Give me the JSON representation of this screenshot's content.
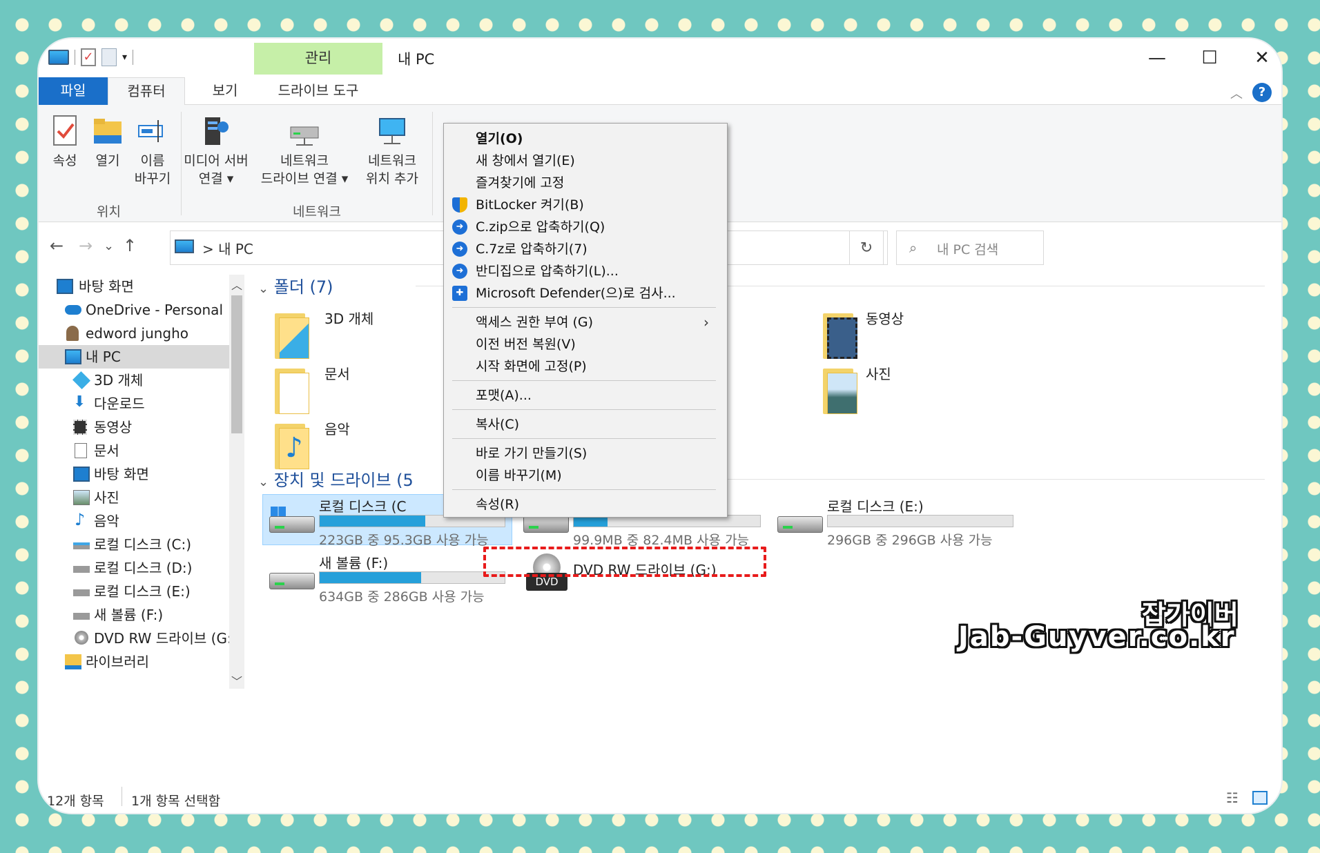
{
  "window": {
    "title": "내 PC",
    "contextual_tab": "관리",
    "controls": {
      "minimize": "—",
      "maximize": "☐",
      "close": "✕"
    },
    "help": "?"
  },
  "ribbon_tabs": [
    {
      "label": "파일"
    },
    {
      "label": "컴퓨터"
    },
    {
      "label": "보기"
    },
    {
      "label": "드라이브 도구"
    }
  ],
  "ribbon": {
    "location_group": {
      "label": "위치",
      "buttons": [
        {
          "label": "속성",
          "icon": "properties-icon"
        },
        {
          "label": "열기",
          "icon": "open-folder-icon"
        },
        {
          "label": "이름\n바꾸기",
          "line1": "이름",
          "line2": "바꾸기",
          "icon": "rename-icon"
        }
      ]
    },
    "network_group": {
      "label": "네트워크",
      "buttons": [
        {
          "line1": "미디어 서버",
          "line2": "연결 ▾",
          "icon": "media-server-icon"
        },
        {
          "line1": "네트워크",
          "line2": "드라이브 연결 ▾",
          "icon": "network-drive-icon"
        },
        {
          "line1": "네트워크",
          "line2": "위치 추가",
          "icon": "network-location-icon"
        }
      ]
    }
  },
  "address": {
    "back": "←",
    "forward": "→",
    "recent": "⌄",
    "up": "↑",
    "crumb": "> 내 PC",
    "dropdown": "⌄",
    "refresh": "↻",
    "search_placeholder": "내 PC 검색"
  },
  "nav_pane": [
    {
      "label": "바탕 화면",
      "icon": "desktop-icon",
      "indent": 0
    },
    {
      "label": "OneDrive - Personal",
      "icon": "onedrive-icon",
      "indent": 1
    },
    {
      "label": "edword jungho",
      "icon": "user-icon",
      "indent": 1
    },
    {
      "label": "내 PC",
      "icon": "pc-icon",
      "indent": 1,
      "selected": true
    },
    {
      "label": "3D 개체",
      "icon": "3d-objects-icon",
      "indent": 2
    },
    {
      "label": "다운로드",
      "icon": "download-icon",
      "indent": 2
    },
    {
      "label": "동영상",
      "icon": "video-icon",
      "indent": 2
    },
    {
      "label": "문서",
      "icon": "document-icon",
      "indent": 2
    },
    {
      "label": "바탕 화면",
      "icon": "desktop-icon",
      "indent": 2
    },
    {
      "label": "사진",
      "icon": "picture-icon",
      "indent": 2
    },
    {
      "label": "음악",
      "icon": "music-icon",
      "indent": 2
    },
    {
      "label": "로컬 디스크 (C:)",
      "icon": "windows-drive-icon",
      "indent": 2
    },
    {
      "label": "로컬 디스크 (D:)",
      "icon": "drive-icon",
      "indent": 2
    },
    {
      "label": "로컬 디스크 (E:)",
      "icon": "drive-icon",
      "indent": 2
    },
    {
      "label": "새 볼륨 (F:)",
      "icon": "drive-icon",
      "indent": 2
    },
    {
      "label": "DVD RW 드라이브 (G:)",
      "icon": "dvd-icon",
      "indent": 2
    },
    {
      "label": "라이브러리",
      "icon": "library-icon",
      "indent": 1
    }
  ],
  "sections": {
    "folders": "폴더 (7)",
    "devices": "장치 및 드라이브 (5"
  },
  "folders": [
    {
      "name": "3D 개체",
      "icon": "3d-objects-icon"
    },
    {
      "name": "문서",
      "icon": "document-icon"
    },
    {
      "name": "음악",
      "icon": "music-icon"
    },
    {
      "name": "동영상",
      "icon": "video-icon"
    },
    {
      "name": "사진",
      "icon": "picture-icon"
    }
  ],
  "drives": [
    {
      "name": "로컬 디스크 (C",
      "info": "223GB 중 95.3GB 사용 가능",
      "used": 0.57,
      "selected": true,
      "icon": "windows-drive-icon"
    },
    {
      "name": "",
      "info": "99.9MB 중 82.4MB 사용 가능",
      "used": 0.18,
      "icon": "drive-icon"
    },
    {
      "name": "로컬 디스크 (E:)",
      "info": "296GB 중 296GB 사용 가능",
      "used": 0.0,
      "icon": "drive-icon"
    },
    {
      "name": "새 볼륨 (F:)",
      "info": "634GB 중 286GB 사용 가능",
      "used": 0.55,
      "icon": "drive-icon"
    },
    {
      "name": "DVD RW 드라이브 (G:)",
      "icon": "dvd-icon",
      "badge": "DVD"
    }
  ],
  "context_menu": [
    {
      "label": "열기(O)",
      "bold": true
    },
    {
      "label": "새 창에서 열기(E)"
    },
    {
      "label": "즐겨찾기에 고정"
    },
    {
      "label": "BitLocker 켜기(B)",
      "icon": "shield-icon"
    },
    {
      "label": "C.zip으로 압축하기(Q)",
      "icon": "bandizip-icon"
    },
    {
      "label": "C.7z로 압축하기(7)",
      "icon": "bandizip-icon"
    },
    {
      "label": "반디집으로 압축하기(L)...",
      "icon": "bandizip-icon"
    },
    {
      "label": "Microsoft Defender(으)로 검사...",
      "icon": "defender-icon"
    },
    {
      "label": "액세스 권한 부여 (G)",
      "submenu": "›"
    },
    {
      "label": "이전 버전 복원(V)"
    },
    {
      "label": "시작 화면에 고정(P)"
    },
    {
      "label": "포맷(A)..."
    },
    {
      "label": "복사(C)"
    },
    {
      "label": "바로 가기 만들기(S)"
    },
    {
      "label": "이름 바꾸기(M)"
    },
    {
      "label": "속성(R)",
      "highlighted": true
    }
  ],
  "status_bar": {
    "count": "12개 항목",
    "selected": "1개 항목 선택함"
  },
  "watermark": {
    "line1": "잡가이버",
    "line2": "Jab-Guyver.co.kr"
  },
  "colors": {
    "accent": "#1a6fc9",
    "manage_tab": "#c6efa8",
    "drive_fill": "#26a0da",
    "selection": "#cce8ff",
    "highlight_dash": "#e81b1b",
    "background": "#6fc7c0"
  }
}
